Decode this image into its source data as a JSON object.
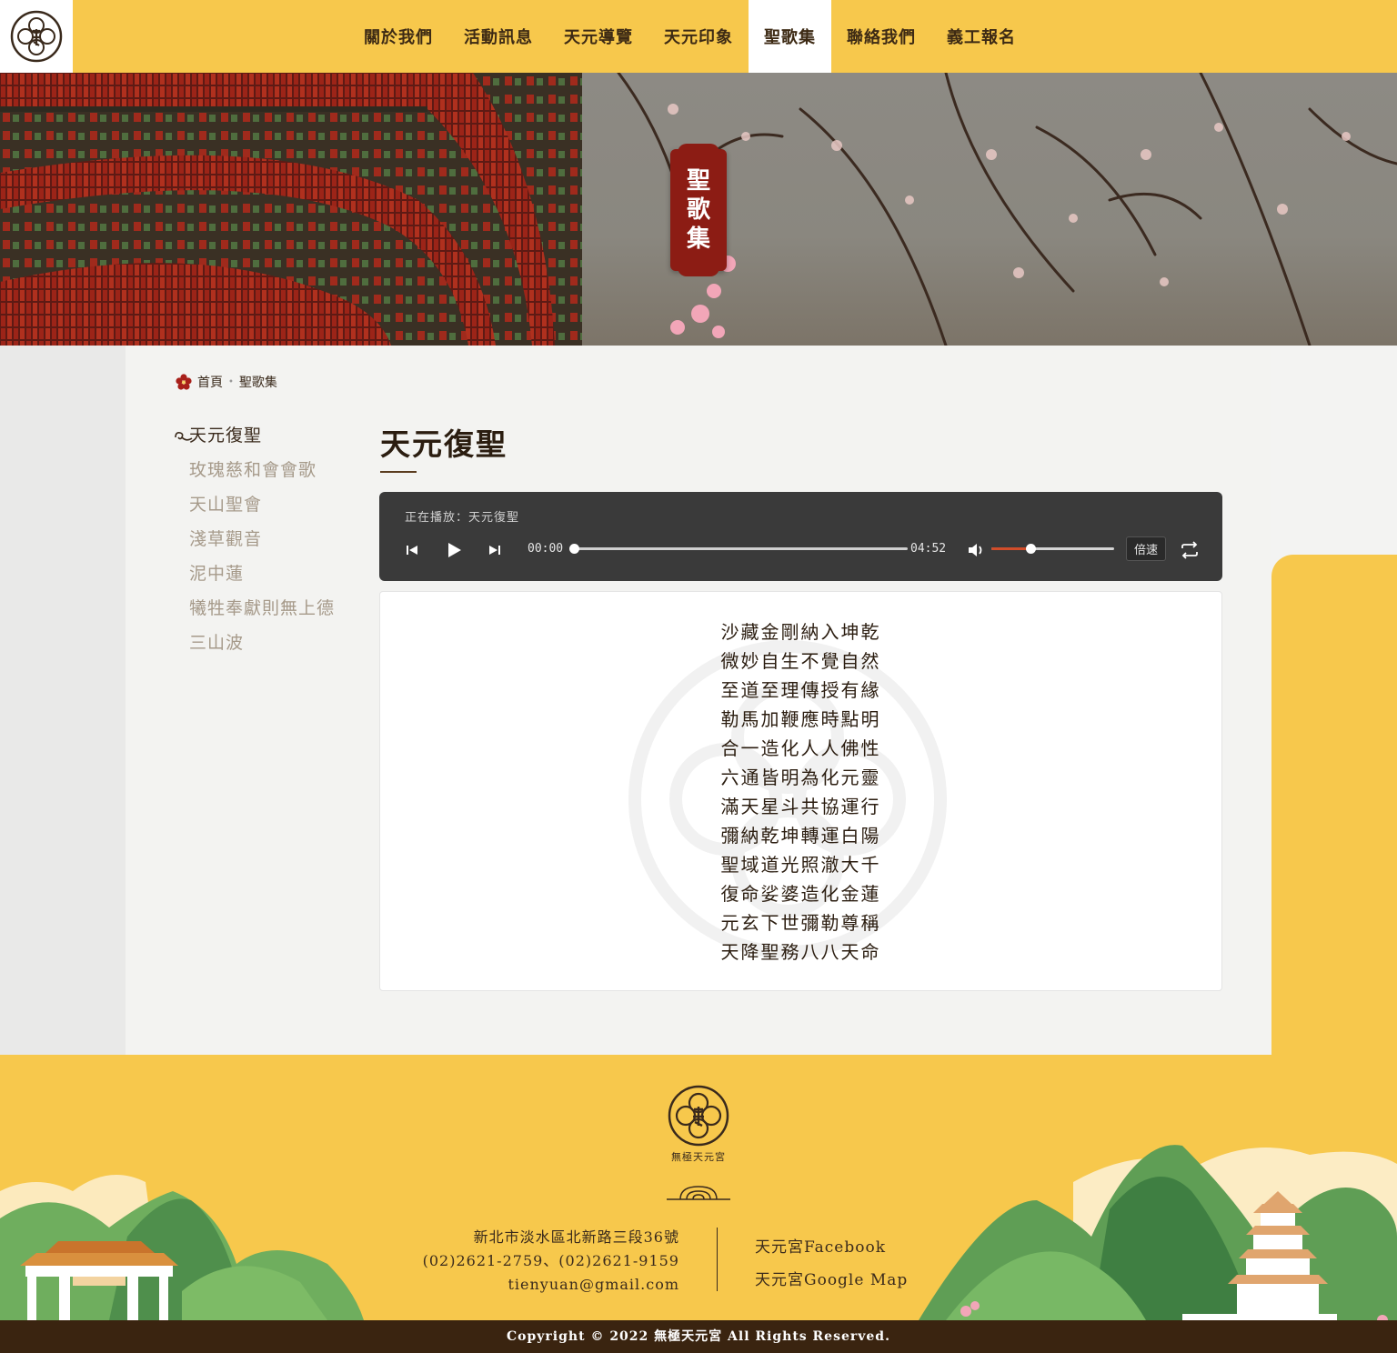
{
  "nav": {
    "items": [
      {
        "label": "關於我們",
        "active": false
      },
      {
        "label": "活動訊息",
        "active": false
      },
      {
        "label": "天元導覽",
        "active": false
      },
      {
        "label": "天元印象",
        "active": false
      },
      {
        "label": "聖歌集",
        "active": true
      },
      {
        "label": "聯絡我們",
        "active": false
      },
      {
        "label": "義工報名",
        "active": false
      }
    ]
  },
  "hero": {
    "title_chars": [
      "聖",
      "歌",
      "集"
    ]
  },
  "breadcrumb": {
    "home": "首頁",
    "current": "聖歌集"
  },
  "sidebar": {
    "items": [
      {
        "label": "天元復聖",
        "active": true
      },
      {
        "label": "玫瑰慈和會會歌",
        "active": false
      },
      {
        "label": "天山聖會",
        "active": false
      },
      {
        "label": "淺草觀音",
        "active": false
      },
      {
        "label": "泥中蓮",
        "active": false
      },
      {
        "label": "犧牲奉獻則無上德",
        "active": false
      },
      {
        "label": "三山波",
        "active": false
      }
    ]
  },
  "main": {
    "title": "天元復聖"
  },
  "player": {
    "now_playing": "正在播放：天元復聖",
    "current_time": "00:00",
    "duration": "04:52",
    "progress": 0,
    "volume": 0.32,
    "speed_label": "倍速"
  },
  "lyrics": [
    "沙藏金剛納入坤乾",
    "微妙自生不覺自然",
    "至道至理傳授有緣",
    "勒馬加鞭應時點明",
    "合一造化人人佛性",
    "六通皆明為化元靈",
    "滿天星斗共協運行",
    "彌納乾坤轉運白陽",
    "聖域道光照澈大千",
    "復命娑婆造化金蓮",
    "元玄下世彌勒尊稱",
    "天降聖務八八天命"
  ],
  "footer": {
    "brand": "無極天元宮",
    "address": "新北市淡水區北新路三段36號",
    "phone": "(02)2621-2759、(02)2621-9159",
    "email": "tienyuan@gmail.com",
    "links": [
      "天元宮Facebook",
      "天元宮Google Map"
    ],
    "copyright": "Copyright © 2022 無極天元宮 All Rights Reserved."
  },
  "colors": {
    "brand_yellow": "#f7c84c",
    "brand_red": "#8c1c14",
    "dark_brown": "#3a2410",
    "player_bg": "#3a3a3a"
  }
}
